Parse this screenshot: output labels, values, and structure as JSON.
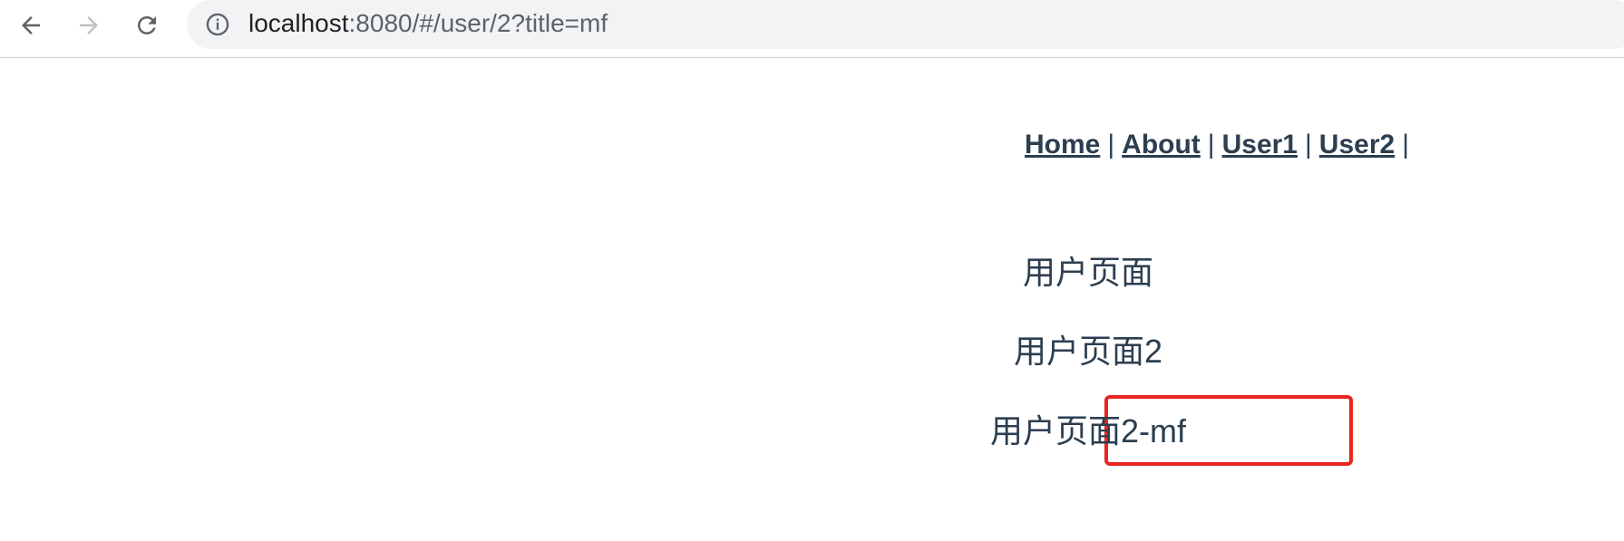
{
  "browser": {
    "url_host": "localhost",
    "url_rest": ":8080/#/user/2?title=mf",
    "back_icon": "arrow-left-icon",
    "forward_icon": "arrow-right-icon",
    "reload_icon": "reload-icon",
    "info_icon": "info-icon"
  },
  "nav": {
    "links": [
      "Home",
      "About",
      "User1",
      "User2"
    ],
    "separator": "|"
  },
  "content": {
    "heading1": "用户页面",
    "heading2": "用户页面2",
    "heading3": "用户页面2-mf"
  },
  "colors": {
    "text": "#2c3e50",
    "highlight_border": "#e8251e",
    "omnibox_bg": "#f1f3f4"
  }
}
